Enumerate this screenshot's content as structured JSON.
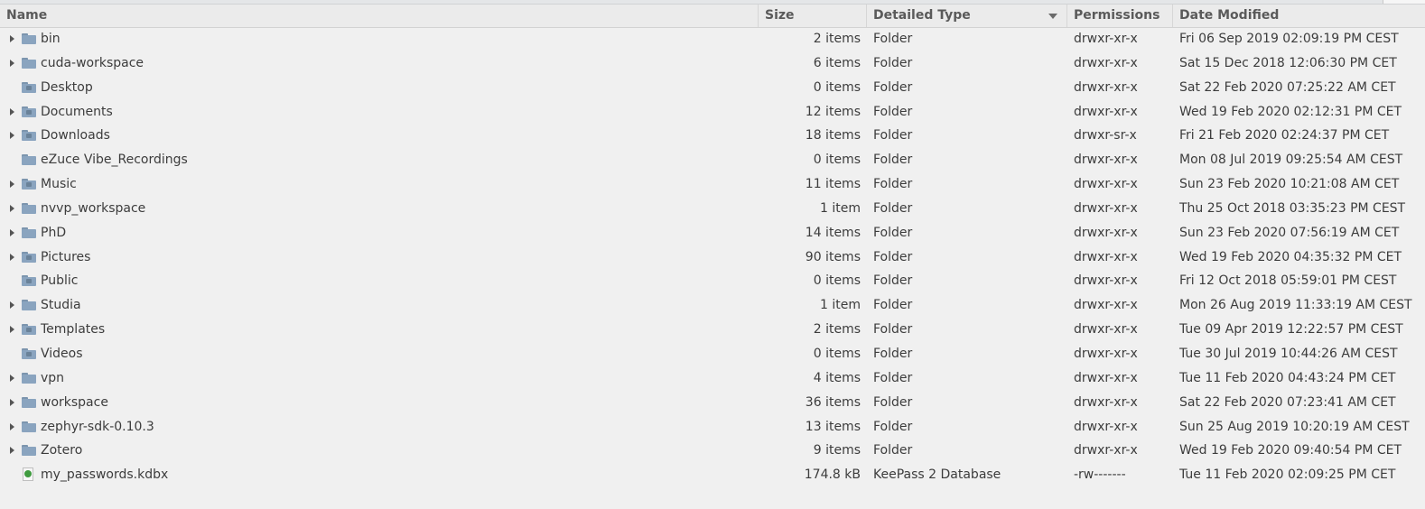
{
  "columns": {
    "name": "Name",
    "size": "Size",
    "type": "Detailed Type",
    "permissions": "Permissions",
    "modified": "Date Modified"
  },
  "colors": {
    "folder": "#8aa4bf",
    "header_bg": "#ebebeb",
    "list_bg": "#f0f0f0"
  },
  "rows": [
    {
      "name": "bin",
      "size": "2 items",
      "type": "Folder",
      "perm": "drwxr-xr-x",
      "date": "Fri 06 Sep 2019 02:09:19 PM CEST",
      "expandable": true,
      "icon": "folder-icon"
    },
    {
      "name": "cuda-workspace",
      "size": "6 items",
      "type": "Folder",
      "perm": "drwxr-xr-x",
      "date": "Sat 15 Dec 2018 12:06:30 PM CET",
      "expandable": true,
      "icon": "folder-icon"
    },
    {
      "name": "Desktop",
      "size": "0 items",
      "type": "Folder",
      "perm": "drwxr-xr-x",
      "date": "Sat 22 Feb 2020 07:25:22 AM CET",
      "expandable": false,
      "icon": "desktop-folder-icon"
    },
    {
      "name": "Documents",
      "size": "12 items",
      "type": "Folder",
      "perm": "drwxr-xr-x",
      "date": "Wed 19 Feb 2020 02:12:31 PM CET",
      "expandable": true,
      "icon": "documents-folder-icon"
    },
    {
      "name": "Downloads",
      "size": "18 items",
      "type": "Folder",
      "perm": "drwxr-sr-x",
      "date": "Fri 21 Feb 2020 02:24:37 PM CET",
      "expandable": true,
      "icon": "downloads-folder-icon"
    },
    {
      "name": "eZuce Vibe_Recordings",
      "size": "0 items",
      "type": "Folder",
      "perm": "drwxr-xr-x",
      "date": "Mon 08 Jul 2019 09:25:54 AM CEST",
      "expandable": false,
      "icon": "folder-icon"
    },
    {
      "name": "Music",
      "size": "11 items",
      "type": "Folder",
      "perm": "drwxr-xr-x",
      "date": "Sun 23 Feb 2020 10:21:08 AM CET",
      "expandable": true,
      "icon": "music-folder-icon"
    },
    {
      "name": "nvvp_workspace",
      "size": "1 item",
      "type": "Folder",
      "perm": "drwxr-xr-x",
      "date": "Thu 25 Oct 2018 03:35:23 PM CEST",
      "expandable": true,
      "icon": "folder-icon"
    },
    {
      "name": "PhD",
      "size": "14 items",
      "type": "Folder",
      "perm": "drwxr-xr-x",
      "date": "Sun 23 Feb 2020 07:56:19 AM CET",
      "expandable": true,
      "icon": "folder-icon"
    },
    {
      "name": "Pictures",
      "size": "90 items",
      "type": "Folder",
      "perm": "drwxr-xr-x",
      "date": "Wed 19 Feb 2020 04:35:32 PM CET",
      "expandable": true,
      "icon": "pictures-folder-icon"
    },
    {
      "name": "Public",
      "size": "0 items",
      "type": "Folder",
      "perm": "drwxr-xr-x",
      "date": "Fri 12 Oct 2018 05:59:01 PM CEST",
      "expandable": false,
      "icon": "public-folder-icon"
    },
    {
      "name": "Studia",
      "size": "1 item",
      "type": "Folder",
      "perm": "drwxr-xr-x",
      "date": "Mon 26 Aug 2019 11:33:19 AM CEST",
      "expandable": true,
      "icon": "folder-icon"
    },
    {
      "name": "Templates",
      "size": "2 items",
      "type": "Folder",
      "perm": "drwxr-xr-x",
      "date": "Tue 09 Apr 2019 12:22:57 PM CEST",
      "expandable": true,
      "icon": "templates-folder-icon"
    },
    {
      "name": "Videos",
      "size": "0 items",
      "type": "Folder",
      "perm": "drwxr-xr-x",
      "date": "Tue 30 Jul 2019 10:44:26 AM CEST",
      "expandable": false,
      "icon": "videos-folder-icon"
    },
    {
      "name": "vpn",
      "size": "4 items",
      "type": "Folder",
      "perm": "drwxr-xr-x",
      "date": "Tue 11 Feb 2020 04:43:24 PM CET",
      "expandable": true,
      "icon": "folder-icon"
    },
    {
      "name": "workspace",
      "size": "36 items",
      "type": "Folder",
      "perm": "drwxr-xr-x",
      "date": "Sat 22 Feb 2020 07:23:41 AM CET",
      "expandable": true,
      "icon": "folder-icon"
    },
    {
      "name": "zephyr-sdk-0.10.3",
      "size": "13 items",
      "type": "Folder",
      "perm": "drwxr-xr-x",
      "date": "Sun 25 Aug 2019 10:20:19 AM CEST",
      "expandable": true,
      "icon": "folder-icon"
    },
    {
      "name": "Zotero",
      "size": "9 items",
      "type": "Folder",
      "perm": "drwxr-xr-x",
      "date": "Wed 19 Feb 2020 09:40:54 PM CET",
      "expandable": true,
      "icon": "folder-icon"
    },
    {
      "name": "my_passwords.kdbx",
      "size": "174.8 kB",
      "type": "KeePass 2 Database",
      "perm": "-rw-------",
      "date": "Tue 11 Feb 2020 02:09:25 PM CET",
      "expandable": false,
      "icon": "keepass-file-icon"
    }
  ]
}
